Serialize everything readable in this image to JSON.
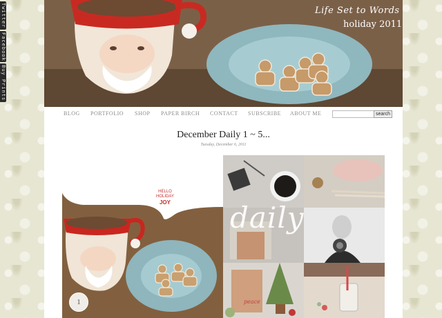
{
  "side_tabs": [
    "Twitter",
    "Facebook",
    "Buy Prints"
  ],
  "header": {
    "title": "Life Set to Words",
    "subtitle": "holiday 2011"
  },
  "nav": {
    "items": [
      "BLOG",
      "PORTFOLIO",
      "SHOP",
      "PAPER BIRCH",
      "CONTACT",
      "SUBSCRIBE",
      "ABOUT ME"
    ],
    "search_value": "",
    "search_button": "search"
  },
  "post": {
    "title": "December Daily 1 ~ 5...",
    "date": "Tuesday, December 6, 2011",
    "collage": {
      "hello_lines": [
        "HELLO",
        "HOLIDAY"
      ],
      "hello_joy": "JOY",
      "page_number": "1",
      "daily_text": "daily",
      "peace_text": "peace"
    }
  }
}
